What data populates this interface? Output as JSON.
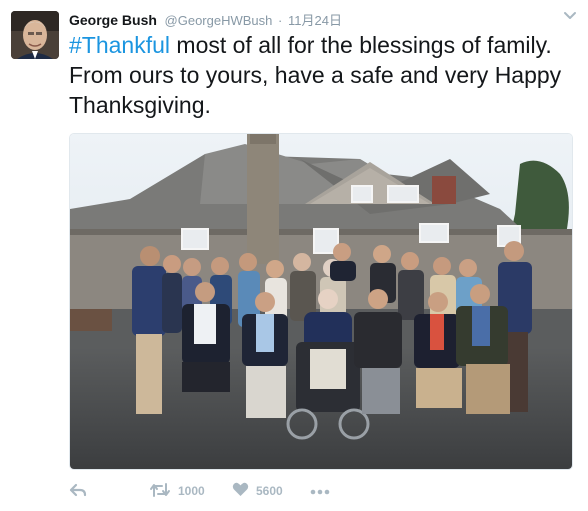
{
  "tweet": {
    "author_name": "George Bush",
    "author_handle": "@GeorgeHWBush",
    "separator": "·",
    "timestamp": "11月24日",
    "hashtag": "#Thankful",
    "body_text": " most of all for the blessings of family. From ours to yours, have a safe and very Happy Thanksgiving."
  },
  "actions": {
    "reply_icon": "reply-arrow-icon",
    "retweet_icon": "retweet-icon",
    "retweet_count": "1000",
    "like_icon": "heart-icon",
    "like_count": "5600",
    "more_icon": "more-dots-icon"
  },
  "colors": {
    "link": "#1b95e0",
    "muted": "#8899a6",
    "action_gray": "#aab8c2",
    "text": "#14171a"
  }
}
